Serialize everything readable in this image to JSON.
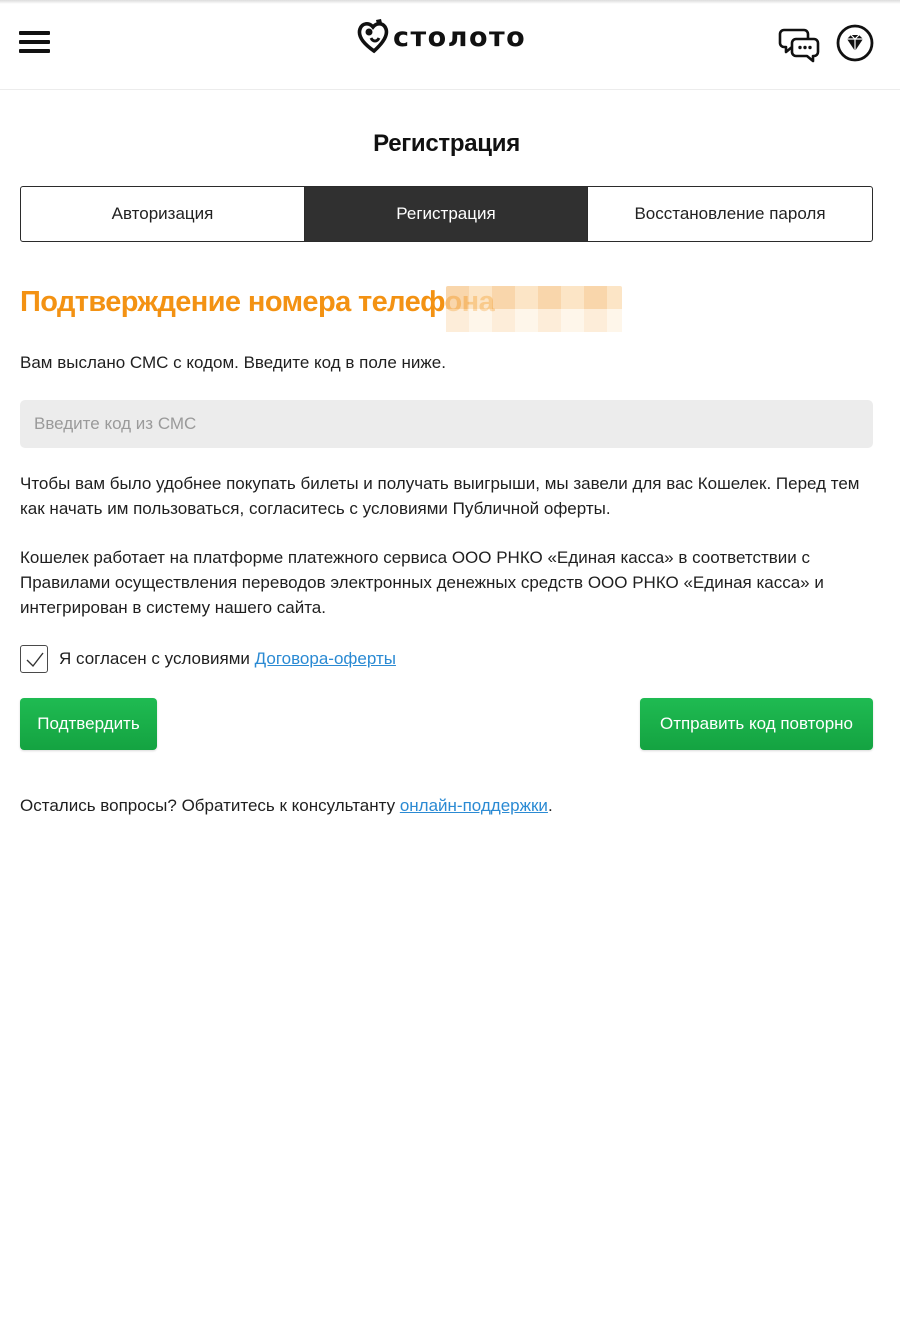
{
  "header": {
    "logo_text": "столото",
    "menu_icon": "hamburger-menu-icon",
    "chat_icon": "chat-support-icon",
    "bonus_icon": "diamond-icon"
  },
  "page_title": "Регистрация",
  "tabs": [
    {
      "label": "Авторизация",
      "active": false
    },
    {
      "label": "Регистрация",
      "active": true
    },
    {
      "label": "Восстановление пароля",
      "active": false
    }
  ],
  "confirm": {
    "title": "Подтверждение номера телефона",
    "sms_note": "Вам выслано СМС с кодом. Введите код в поле ниже.",
    "code_input": {
      "placeholder": "Введите код из СМС",
      "value": ""
    }
  },
  "wallet": {
    "paragraph1": "Чтобы вам было удобнее покупать билеты и получать выигрыши, мы завели для вас Кошелек. Перед тем как начать им пользоваться, согласитесь с условиями Публичной оферты.",
    "paragraph2": "Кошелек работает на платформе платежного сервиса ООО РНКО «Единая касса» в соответствии с Правилами осуществления переводов электронных денежных средств ООО РНКО «Единая касса» и интегрирован в систему нашего сайта."
  },
  "agreement": {
    "checked": true,
    "label": "Я согласен с условиями ",
    "link": "Договора-оферты"
  },
  "buttons": {
    "confirm": "Подтвердить",
    "resend": "Отправить код повторно"
  },
  "support": {
    "text": "Остались вопросы? Обратитесь к консультанту ",
    "link": "онлайн-поддержки",
    "suffix": "."
  },
  "colors": {
    "accent_orange": "#f39213",
    "button_green": "#1aaf4a",
    "active_tab": "#303030",
    "link_blue": "#2a8ad3"
  }
}
